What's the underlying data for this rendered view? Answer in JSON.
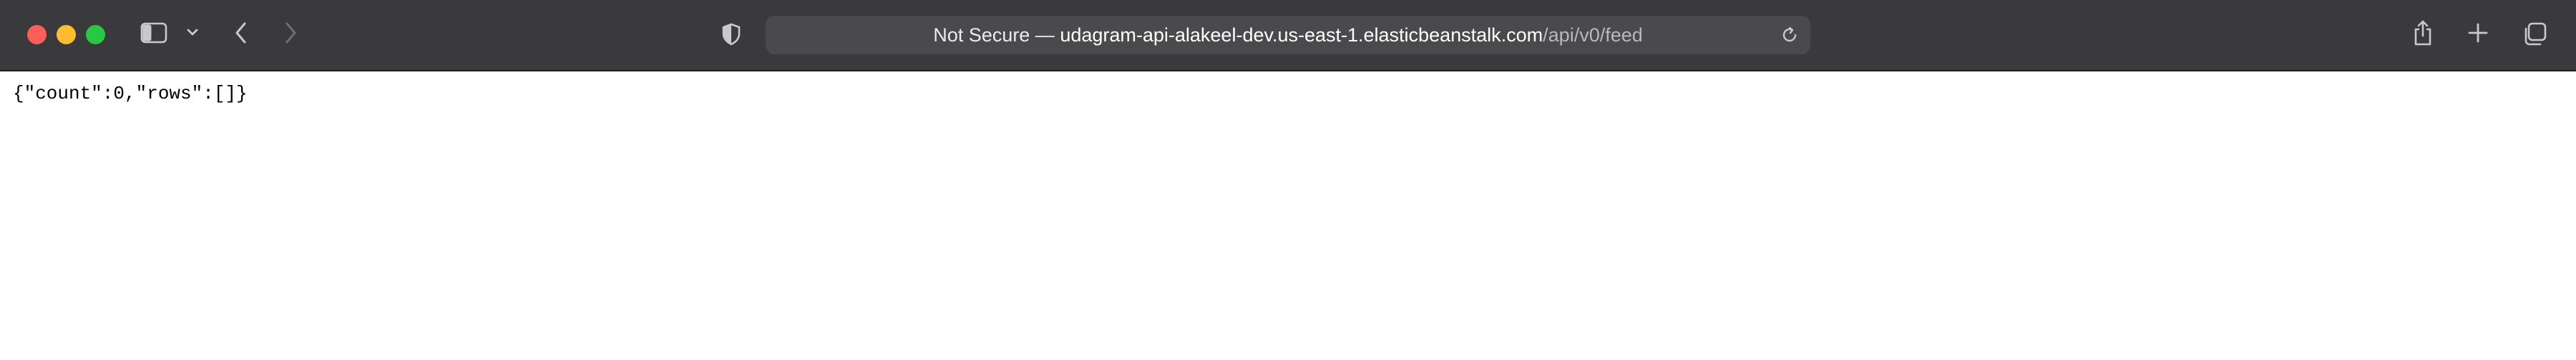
{
  "browser": {
    "address": {
      "security_label": "Not Secure",
      "separator": " — ",
      "host": "udagram-api-alakeel-dev.us-east-1.elasticbeanstalk.com",
      "path": "/api/v0/feed"
    },
    "icons": {
      "sidebar": "sidebar-icon",
      "sidebar_menu": "chevron-down-icon",
      "back": "chevron-left-icon",
      "forward": "chevron-right-icon",
      "privacy": "shield-icon",
      "reload": "reload-icon",
      "share": "share-icon",
      "new_tab": "plus-icon",
      "tab_overview": "tab-overview-icon"
    },
    "colors": {
      "toolbar": "#3a3a3c",
      "address_bar": "#4a4a4c",
      "close": "#ff5f57",
      "minimize": "#febc2e",
      "zoom": "#28c840"
    }
  },
  "page": {
    "body_text": "{\"count\":0,\"rows\":[]}"
  }
}
